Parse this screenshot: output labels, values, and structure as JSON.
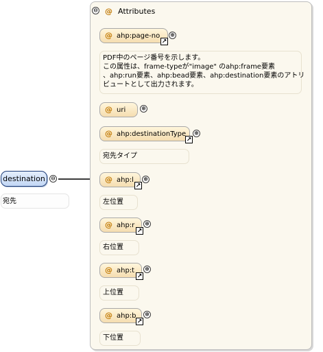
{
  "root": {
    "name": "destination",
    "doc": "宛先"
  },
  "group": {
    "title": "Attributes",
    "at": "@"
  },
  "icons": {
    "collapse": "⊖",
    "expand": "⊕",
    "reference": "↗"
  },
  "attributes": [
    {
      "name": "ahp:page-no",
      "doc_lines": [
        "PDF中のページ番号を示します。",
        "この属性は、frame-typeが\"image\" のahp:frame要素",
        "、ahp:run要素、ahp:bead要素、ahp:destination要素のアトリ",
        "ビュートとして出力されます。"
      ]
    },
    {
      "name": "uri",
      "doc_lines": []
    },
    {
      "name": "ahp:destinationType",
      "doc_lines": [
        "宛先タイプ"
      ]
    },
    {
      "name": "ahp:l",
      "doc_lines": [
        "左位置"
      ]
    },
    {
      "name": "ahp:r",
      "doc_lines": [
        "右位置"
      ]
    },
    {
      "name": "ahp:t",
      "doc_lines": [
        "上位置"
      ]
    },
    {
      "name": "ahp:b",
      "doc_lines": [
        "下位置"
      ]
    }
  ]
}
